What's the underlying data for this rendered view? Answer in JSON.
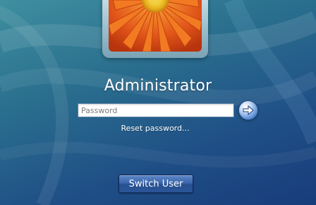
{
  "login": {
    "username": "Administrator",
    "password_placeholder": "Password",
    "password_value": "",
    "reset_link": "Reset password...",
    "switch_user": "Switch User"
  },
  "icons": {
    "submit": "arrow-right-icon",
    "user_picture": "orange-flower-picture"
  },
  "colors": {
    "background_top": "#3f8fa0",
    "background_bottom": "#183d7a",
    "button_blue": "#3b67ad",
    "flower_orange": "#f26a1b",
    "flower_center": "#f2c21a"
  }
}
